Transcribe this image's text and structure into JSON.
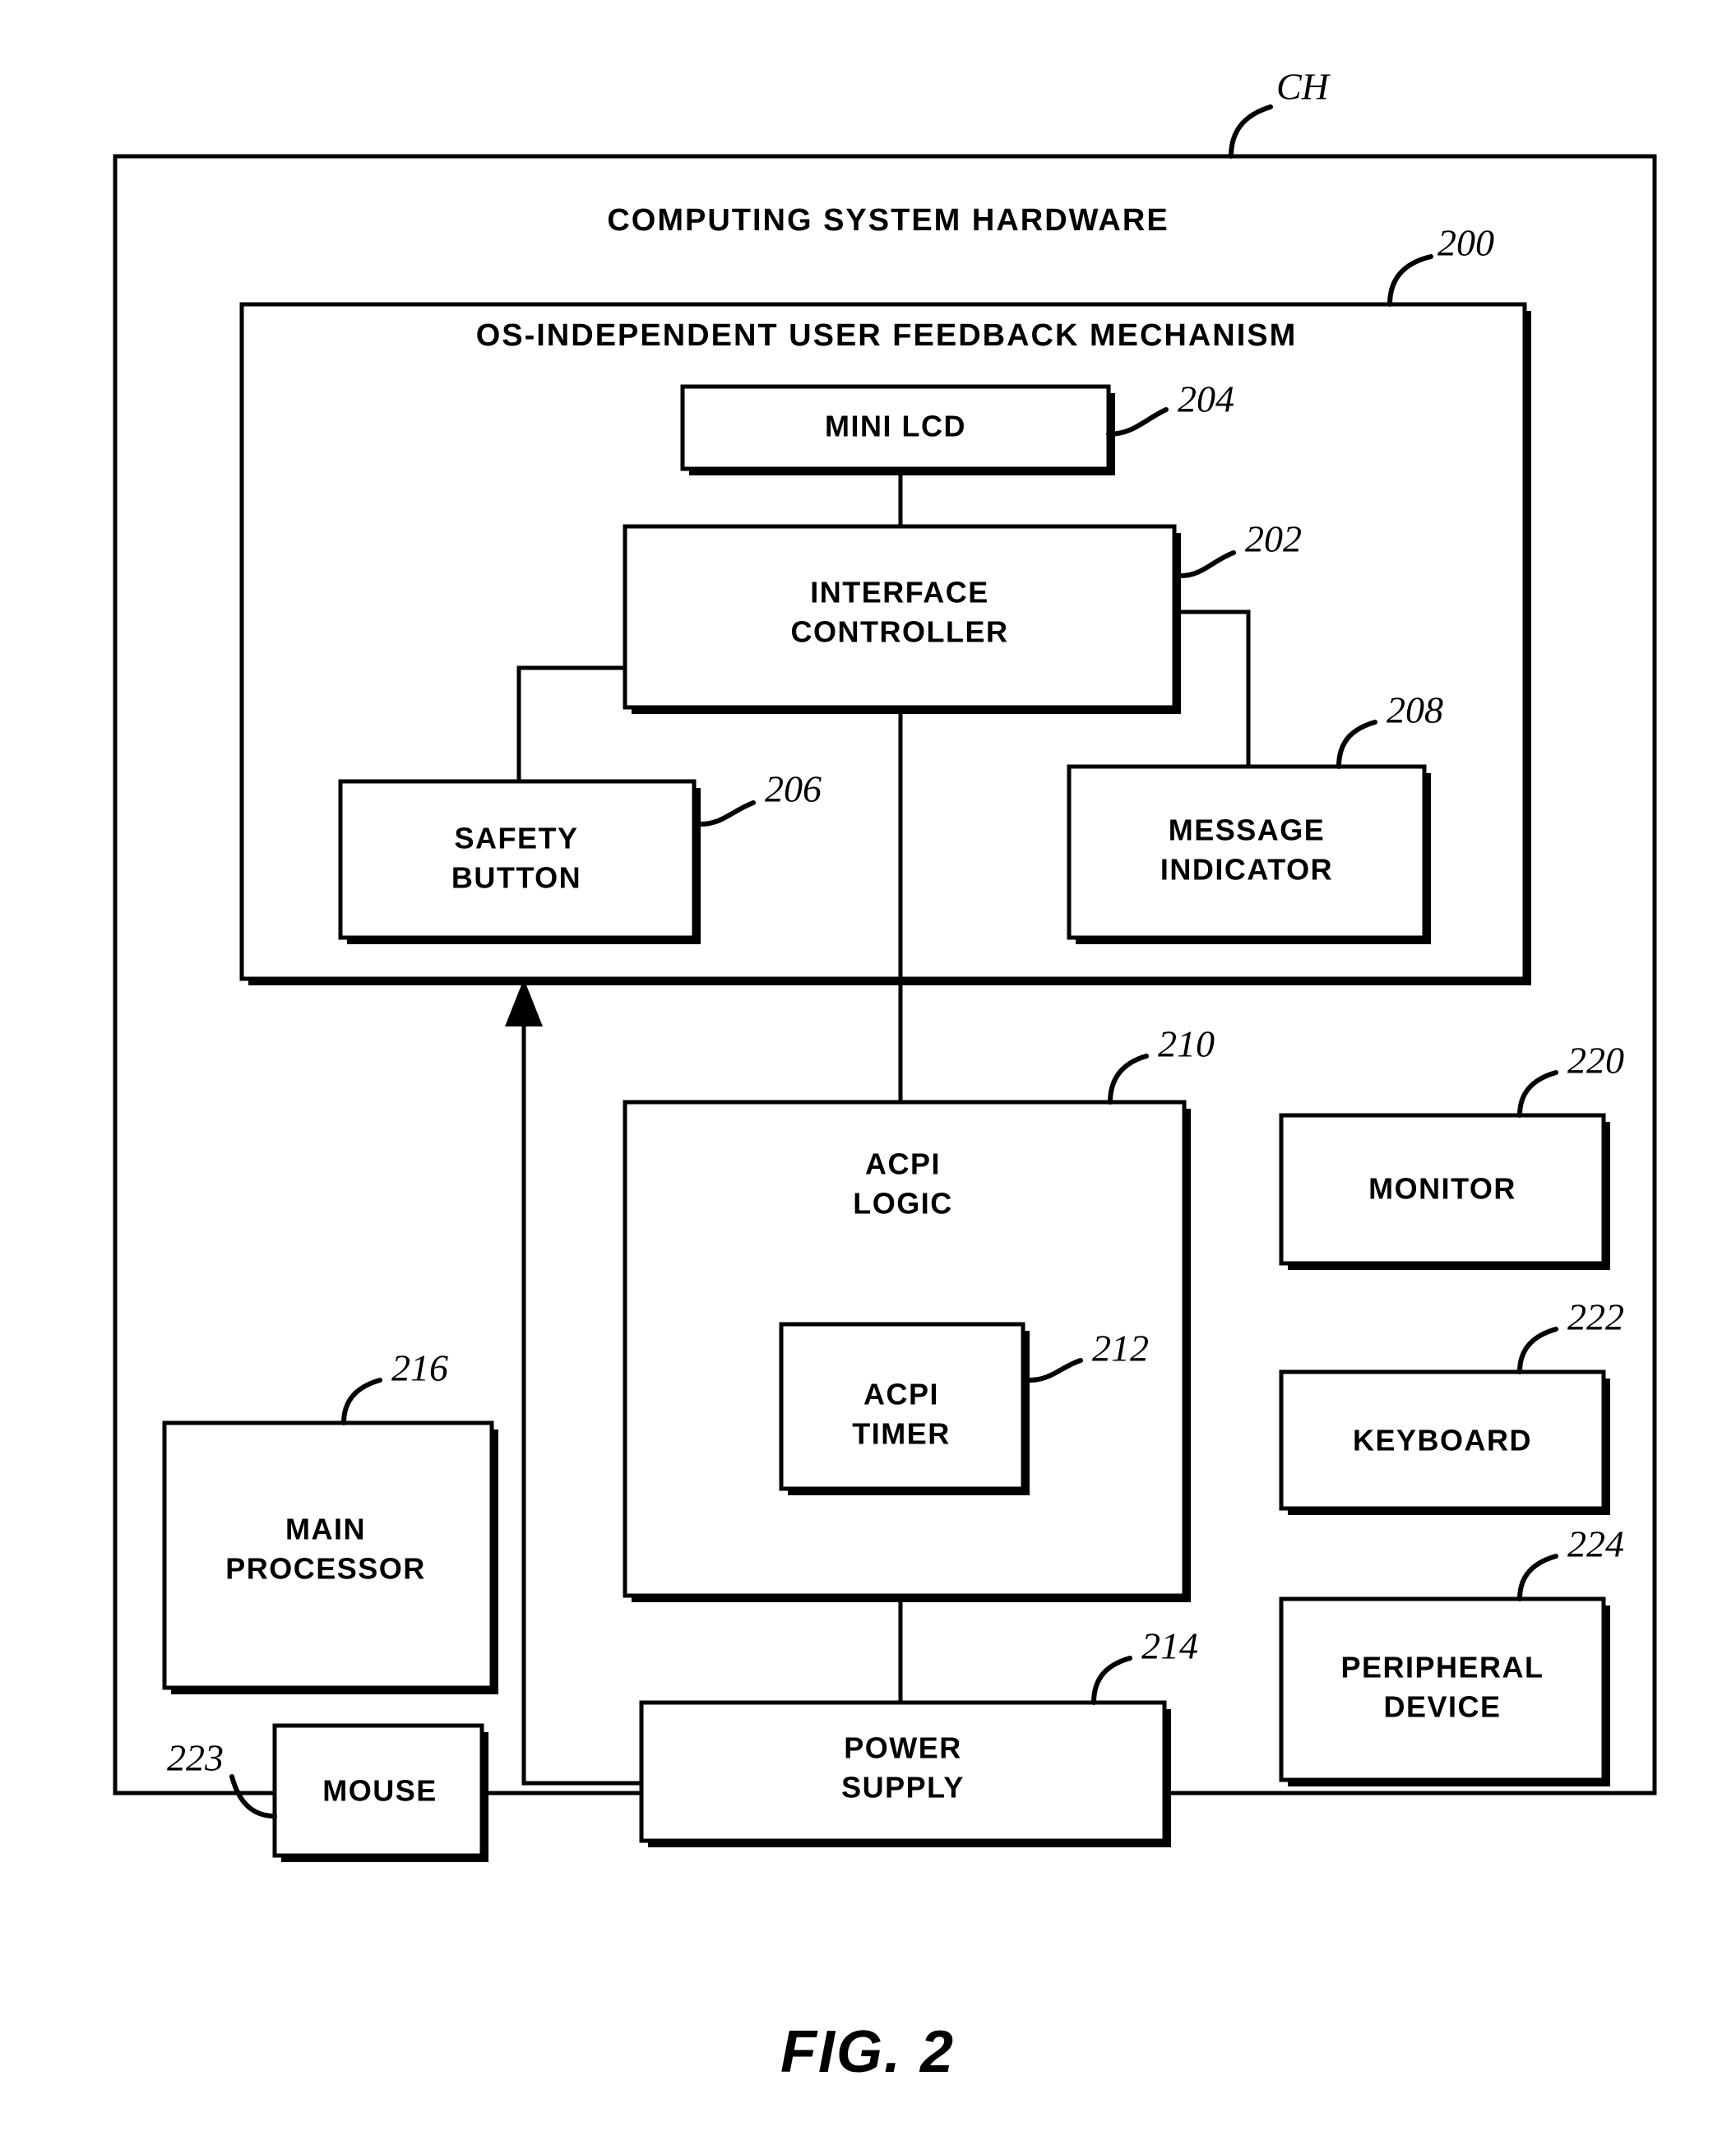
{
  "figure": {
    "caption": "FIG. 2",
    "outer_label": "CH",
    "outer_title": "COMPUTING SYSTEM HARDWARE",
    "inner_title": "OS-INDEPENDENT USER FEEDBACK MECHANISM",
    "inner_ref": "200"
  },
  "blocks": {
    "mini_lcd": {
      "label": "MINI LCD",
      "ref": "204"
    },
    "interface_line1": {
      "label": "INTERFACE"
    },
    "interface_line2": {
      "label": "CONTROLLER"
    },
    "interface_ref": {
      "ref": "202"
    },
    "safety_line1": {
      "label": "SAFETY"
    },
    "safety_line2": {
      "label": "BUTTON"
    },
    "safety_ref": {
      "ref": "206"
    },
    "message_line1": {
      "label": "MESSAGE"
    },
    "message_line2": {
      "label": "INDICATOR"
    },
    "message_ref": {
      "ref": "208"
    },
    "acpi_line1": {
      "label": "ACPI"
    },
    "acpi_line2": {
      "label": "LOGIC"
    },
    "acpi_ref": {
      "ref": "210"
    },
    "timer_line1": {
      "label": "ACPI"
    },
    "timer_line2": {
      "label": "TIMER"
    },
    "timer_ref": {
      "ref": "212"
    },
    "power_line1": {
      "label": "POWER"
    },
    "power_line2": {
      "label": "SUPPLY"
    },
    "power_ref": {
      "ref": "214"
    },
    "processor_line1": {
      "label": "MAIN"
    },
    "processor_line2": {
      "label": "PROCESSOR"
    },
    "processor_ref": {
      "ref": "216"
    },
    "mouse": {
      "label": "MOUSE",
      "ref": "223"
    },
    "monitor": {
      "label": "MONITOR",
      "ref": "220"
    },
    "keyboard": {
      "label": "KEYBOARD",
      "ref": "222"
    },
    "peripheral_line1": {
      "label": "PERIPHERAL"
    },
    "peripheral_line2": {
      "label": "DEVICE"
    },
    "peripheral_ref": {
      "ref": "224"
    }
  },
  "colors": {
    "ink": "#000000",
    "paper": "#ffffff"
  }
}
